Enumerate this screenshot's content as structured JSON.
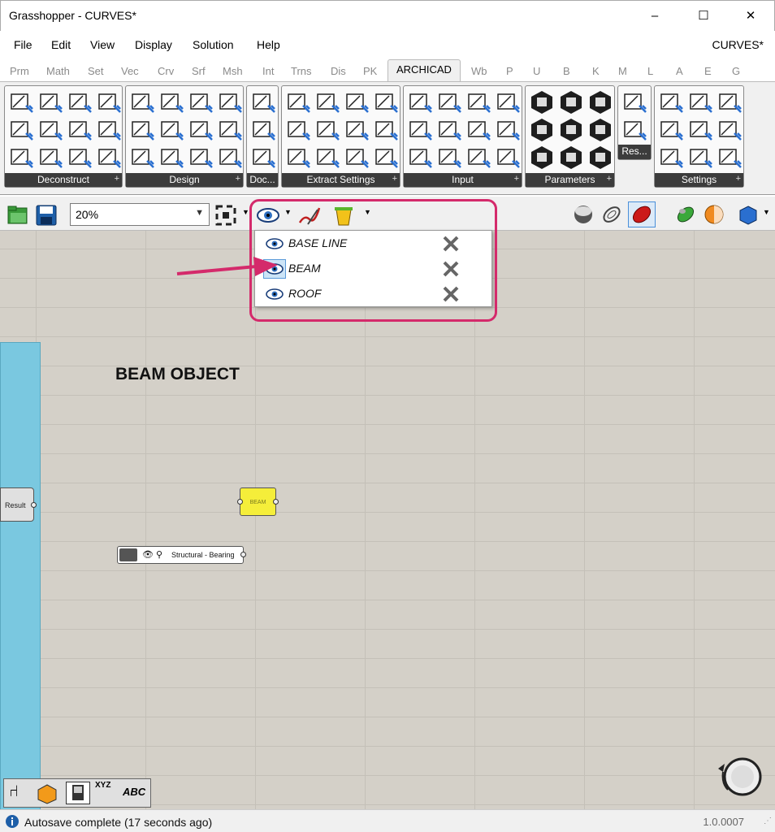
{
  "window": {
    "title": "Grasshopper - CURVES*",
    "minimize": "–",
    "maximize": "☐",
    "close": "✕"
  },
  "menu": {
    "items": [
      "File",
      "Edit",
      "View",
      "Display",
      "Solution",
      "Help"
    ],
    "document": "CURVES*"
  },
  "tabs": {
    "items": [
      "Prm",
      "Math",
      "Set",
      "Vec",
      "Crv",
      "Srf",
      "Msh",
      "Int",
      "Trns",
      "Dis",
      "PK",
      "ARCHICAD",
      "Wb",
      "P",
      "U",
      "B",
      "K",
      "M",
      "L",
      "A",
      "E",
      "G"
    ],
    "active": "ARCHICAD"
  },
  "ribbon": {
    "groups": [
      "Deconstruct",
      "Design",
      "Doc...",
      "Extract Settings",
      "Input",
      "Parameters",
      "Res...",
      "Settings"
    ]
  },
  "toolbar": {
    "zoom": "20%"
  },
  "dropdown": {
    "items": [
      "BASE LINE",
      "BEAM",
      "ROOF"
    ]
  },
  "canvas": {
    "heading": "BEAM OBJECT",
    "result_node": "Result",
    "beam_node": "BEAM",
    "struct_node": "Structural - Bearing"
  },
  "status": {
    "text": "Autosave complete (17 seconds ago)",
    "version": "1.0.0007"
  },
  "colors": {
    "highlight": "#d42a6b",
    "canvas": "#d4d0c8",
    "panel": "#7ac8e0",
    "beam_node": "#f5ee3a"
  }
}
